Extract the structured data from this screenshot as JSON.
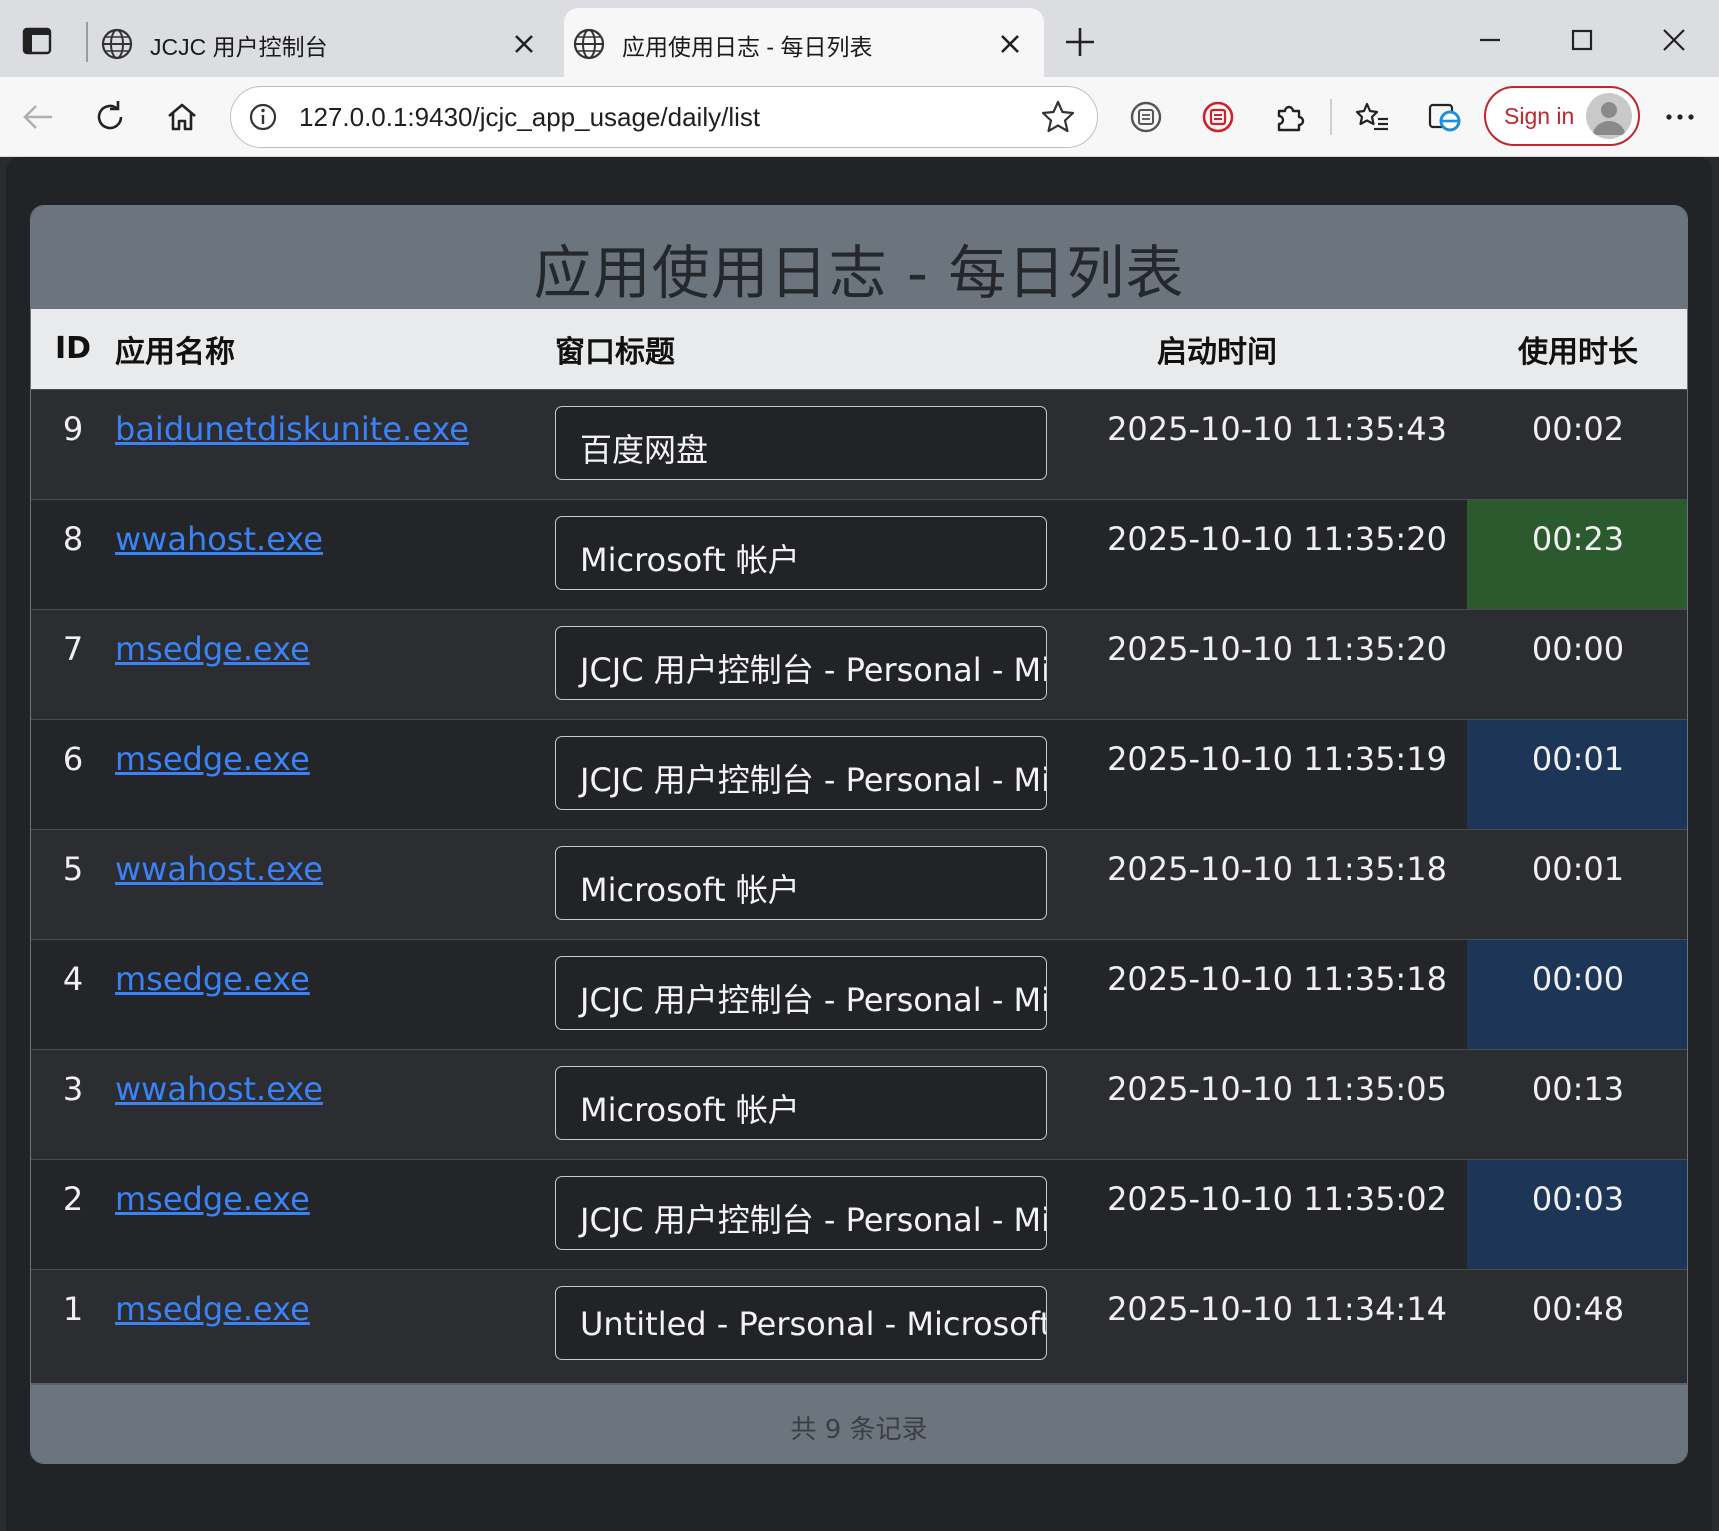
{
  "browser": {
    "tabs": [
      {
        "title": "JCJC 用户控制台",
        "active": false
      },
      {
        "title": "应用使用日志 - 每日列表",
        "active": true
      }
    ],
    "url": "127.0.0.1:9430/jcjc_app_usage/daily/list",
    "signin_label": "Sign in",
    "accent_color": "#c0262d"
  },
  "page": {
    "title": "应用使用日志 - 每日列表",
    "columns": {
      "id": "ID",
      "app": "应用名称",
      "window": "窗口标题",
      "start": "启动时间",
      "duration": "使用时长"
    },
    "rows": [
      {
        "id": "9",
        "app": "baidunetdiskunite.exe",
        "window": "百度网盘",
        "start": "2025-10-10 11:35:43",
        "duration": "00:02",
        "highlight": "none"
      },
      {
        "id": "8",
        "app": "wwahost.exe",
        "window": "Microsoft 帐户",
        "start": "2025-10-10 11:35:20",
        "duration": "00:23",
        "highlight": "green"
      },
      {
        "id": "7",
        "app": "msedge.exe",
        "window": "JCJC 用户控制台 - Personal - Microsoft Edge",
        "start": "2025-10-10 11:35:20",
        "duration": "00:00",
        "highlight": "none"
      },
      {
        "id": "6",
        "app": "msedge.exe",
        "window": "JCJC 用户控制台 - Personal - Microsoft Edge",
        "start": "2025-10-10 11:35:19",
        "duration": "00:01",
        "highlight": "blue"
      },
      {
        "id": "5",
        "app": "wwahost.exe",
        "window": "Microsoft 帐户",
        "start": "2025-10-10 11:35:18",
        "duration": "00:01",
        "highlight": "none"
      },
      {
        "id": "4",
        "app": "msedge.exe",
        "window": "JCJC 用户控制台 - Personal - Microsoft Edge",
        "start": "2025-10-10 11:35:18",
        "duration": "00:00",
        "highlight": "blue"
      },
      {
        "id": "3",
        "app": "wwahost.exe",
        "window": "Microsoft 帐户",
        "start": "2025-10-10 11:35:05",
        "duration": "00:13",
        "highlight": "none"
      },
      {
        "id": "2",
        "app": "msedge.exe",
        "window": "JCJC 用户控制台 - Personal - Microsoft Edge",
        "start": "2025-10-10 11:35:02",
        "duration": "00:03",
        "highlight": "blue"
      },
      {
        "id": "1",
        "app": "msedge.exe",
        "window": "Untitled - Personal - Microsoft Edge",
        "start": "2025-10-10 11:34:14",
        "duration": "00:48",
        "highlight": "none"
      }
    ],
    "footer": "共 9 条记录",
    "colors": {
      "highlight_green": "#2a5a2d",
      "highlight_blue": "#1d3657",
      "link": "#3b82f6",
      "header_bg": "#6c757d"
    }
  }
}
